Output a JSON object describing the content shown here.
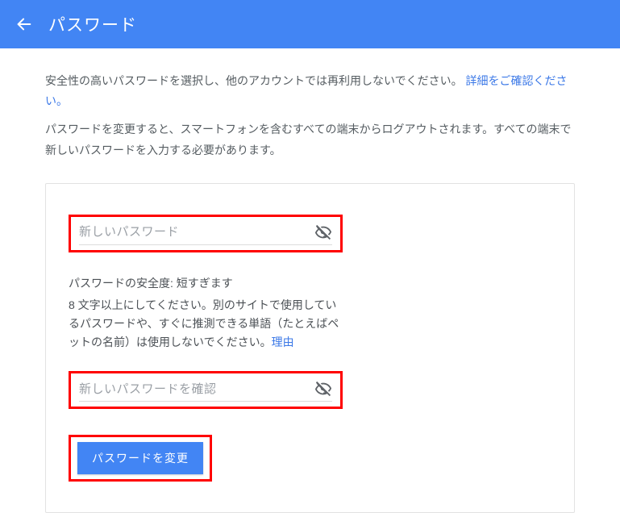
{
  "header": {
    "title": "パスワード"
  },
  "intro": {
    "line1_pre": "安全性の高いパスワードを選択し、他のアカウントでは再利用しないでください。",
    "learn_more_link": "詳細をご確認ください。",
    "line2": "パスワードを変更すると、スマートフォンを含むすべての端末からログアウトされます。すべての端末で新しいパスワードを入力する必要があります。"
  },
  "form": {
    "new_password_placeholder": "新しいパスワード",
    "strength_label": "パスワードの安全度: 短すぎます",
    "strength_help_pre": "8 文字以上にしてください。別のサイトで使用しているパスワードや、すぐに推測できる単語（たとえばペットの名前）は使用しないでください。",
    "reason_link": "理由",
    "confirm_placeholder": "新しいパスワードを確認",
    "submit_label": "パスワードを変更"
  }
}
